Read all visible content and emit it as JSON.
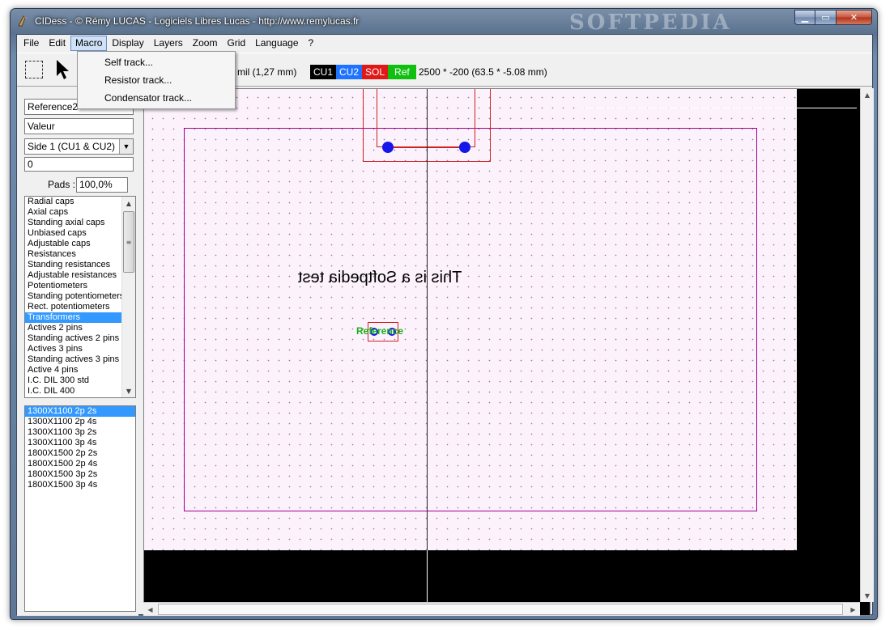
{
  "window": {
    "title": "CIDess - © Rémy LUCAS - Logiciels Libres Lucas - http://www.remylucas.fr",
    "watermark": "SOFTPEDIA"
  },
  "menubar": {
    "items": [
      "File",
      "Edit",
      "Macro",
      "Display",
      "Layers",
      "Zoom",
      "Grid",
      "Language",
      "?"
    ],
    "active": "Macro"
  },
  "macro_menu": {
    "items": [
      "Self track...",
      "Resistor track...",
      "Condensator track..."
    ]
  },
  "toolbar": {
    "grid_text": "mil (1,27 mm)",
    "layers": [
      {
        "label": "CU1",
        "color": "#000000"
      },
      {
        "label": "CU2",
        "color": "#1e74ff"
      },
      {
        "label": "SOL",
        "color": "#e01818"
      },
      {
        "label": "Ref",
        "color": "#10c010"
      }
    ],
    "coords": "2500 * -200 (63.5 * -5.08 mm)"
  },
  "left_panel": {
    "reference": "Reference2",
    "value": "Valeur",
    "side": "Side 1 (CU1 & CU2)",
    "angle": "0",
    "pads_label": "Pads :",
    "pads_value": "100,0%",
    "categories": [
      "Radial caps",
      "Axial caps",
      "Standing axial caps",
      "Unbiased caps",
      "Adjustable caps",
      "Resistances",
      "Standing resistances",
      "Adjustable resistances",
      "Potentiometers",
      "Standing potentiometers",
      "Rect. potentiometers",
      "Transformers",
      "Actives 2 pins",
      "Standing actives 2 pins",
      "Actives 3 pins",
      "Standing actives 3 pins",
      "Active 4 pins",
      "I.C. DIL 300 std",
      "I.C. DIL 400"
    ],
    "selected_category": "Transformers",
    "footprints": [
      "1300X1100 2p 2s",
      "1300X1100 2p 4s",
      "1300X1100 3p 2s",
      "1300X1100 3p 4s",
      "1800X1500 2p 2s",
      "1800X1500 2p 4s",
      "1800X1500 3p 2s",
      "1800X1500 3p 4s"
    ],
    "selected_footprint": "1300X1100 2p 2s"
  },
  "canvas": {
    "mirror_text": "This is a Softpedia test",
    "reference_label": "Reference"
  }
}
